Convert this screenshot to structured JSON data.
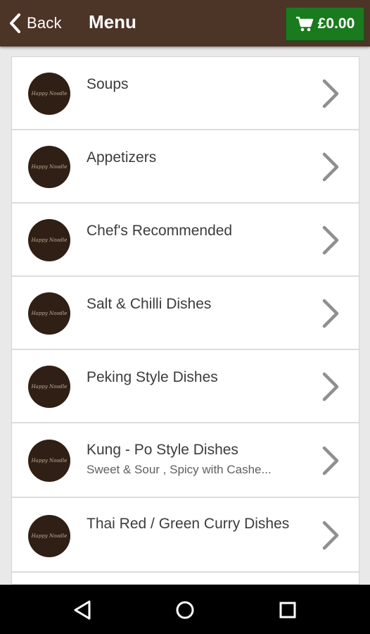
{
  "appbar": {
    "back_label": "Back",
    "title": "Menu",
    "cart_total": "£0.00",
    "background": "#4c3426",
    "cart_color": "#1a7a1e"
  },
  "menu": {
    "categories": [
      {
        "name": "Soups",
        "description": ""
      },
      {
        "name": "Appetizers",
        "description": ""
      },
      {
        "name": "Chef's Recommended",
        "description": ""
      },
      {
        "name": "Salt & Chilli Dishes",
        "description": ""
      },
      {
        "name": "Peking Style Dishes",
        "description": ""
      },
      {
        "name": "Kung - Po Style Dishes",
        "description": "Sweet & Sour , Spicy with Cashe..."
      },
      {
        "name": "Thai Red / Green Curry Dishes",
        "description": ""
      }
    ],
    "logo_text": "Happy Noodle",
    "chevron_icon": "chevron-right-icon"
  },
  "navbar": {
    "icons": [
      "back-triangle-icon",
      "home-circle-icon",
      "recents-square-icon"
    ]
  }
}
